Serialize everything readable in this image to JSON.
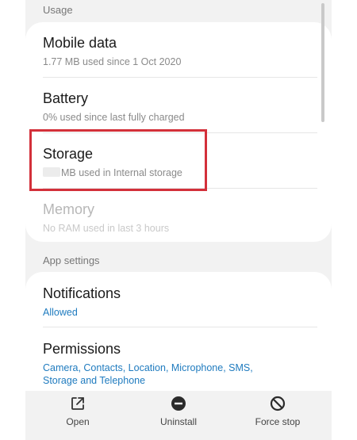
{
  "usage": {
    "header": "Usage",
    "mobile_data": {
      "title": "Mobile data",
      "subtitle": "1.77 MB used since 1 Oct 2020"
    },
    "battery": {
      "title": "Battery",
      "subtitle": "0% used since last fully charged"
    },
    "storage": {
      "title": "Storage",
      "subtitle": "MB used in Internal storage"
    },
    "memory": {
      "title": "Memory",
      "subtitle": "No RAM used in last 3 hours"
    }
  },
  "app_settings": {
    "header": "App settings",
    "notifications": {
      "title": "Notifications",
      "subtitle": "Allowed"
    },
    "permissions": {
      "title": "Permissions",
      "subtitle_line1": "Camera, Contacts, Location, Microphone, SMS,",
      "subtitle_line2": "Storage and Telephone"
    }
  },
  "bottom_actions": {
    "open": {
      "label": "Open",
      "icon": "open-external-icon"
    },
    "uninstall": {
      "label": "Uninstall",
      "icon": "minus-circle-icon"
    },
    "force_stop": {
      "label": "Force stop",
      "icon": "no-entry-icon"
    }
  },
  "colors": {
    "accent": "#1f7bbf",
    "highlight": "#d3303a",
    "background": "#f2f2f2"
  }
}
